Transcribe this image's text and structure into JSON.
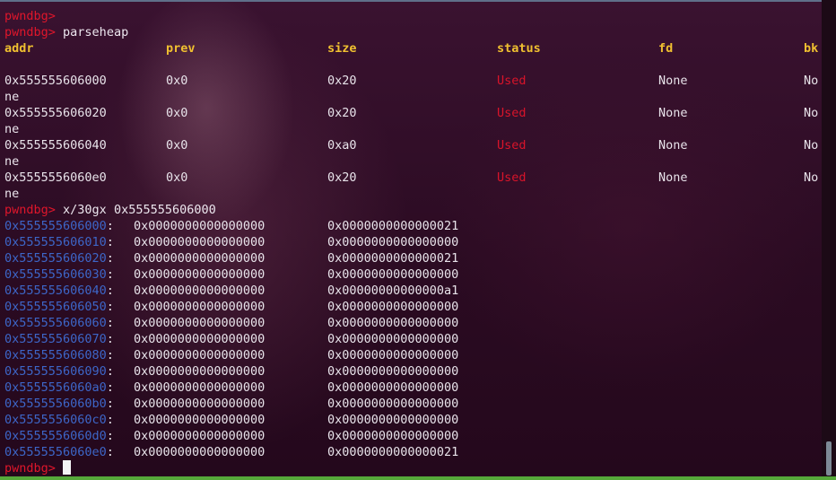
{
  "prompt": "pwndbg>",
  "commands": {
    "parseheap": "parseheap",
    "examine": "x/30gx 0x555555606000"
  },
  "heap_table": {
    "headers": [
      "addr",
      "prev",
      "size",
      "status",
      "fd",
      "bk"
    ],
    "rows": [
      {
        "addr": "0x555555606000",
        "prev": "0x0",
        "size": "0x20",
        "status": "Used",
        "fd": "None",
        "bk": "No",
        "cont": "ne"
      },
      {
        "addr": "0x555555606020",
        "prev": "0x0",
        "size": "0x20",
        "status": "Used",
        "fd": "None",
        "bk": "No",
        "cont": "ne"
      },
      {
        "addr": "0x555555606040",
        "prev": "0x0",
        "size": "0xa0",
        "status": "Used",
        "fd": "None",
        "bk": "No",
        "cont": "ne"
      },
      {
        "addr": "0x5555556060e0",
        "prev": "0x0",
        "size": "0x20",
        "status": "Used",
        "fd": "None",
        "bk": "No",
        "cont": "ne"
      }
    ]
  },
  "memory_dump": [
    {
      "addr": "0x555555606000",
      "v1": "0x0000000000000000",
      "v2": "0x0000000000000021"
    },
    {
      "addr": "0x555555606010",
      "v1": "0x0000000000000000",
      "v2": "0x0000000000000000"
    },
    {
      "addr": "0x555555606020",
      "v1": "0x0000000000000000",
      "v2": "0x0000000000000021"
    },
    {
      "addr": "0x555555606030",
      "v1": "0x0000000000000000",
      "v2": "0x0000000000000000"
    },
    {
      "addr": "0x555555606040",
      "v1": "0x0000000000000000",
      "v2": "0x00000000000000a1"
    },
    {
      "addr": "0x555555606050",
      "v1": "0x0000000000000000",
      "v2": "0x0000000000000000"
    },
    {
      "addr": "0x555555606060",
      "v1": "0x0000000000000000",
      "v2": "0x0000000000000000"
    },
    {
      "addr": "0x555555606070",
      "v1": "0x0000000000000000",
      "v2": "0x0000000000000000"
    },
    {
      "addr": "0x555555606080",
      "v1": "0x0000000000000000",
      "v2": "0x0000000000000000"
    },
    {
      "addr": "0x555555606090",
      "v1": "0x0000000000000000",
      "v2": "0x0000000000000000"
    },
    {
      "addr": "0x5555556060a0",
      "v1": "0x0000000000000000",
      "v2": "0x0000000000000000"
    },
    {
      "addr": "0x5555556060b0",
      "v1": "0x0000000000000000",
      "v2": "0x0000000000000000"
    },
    {
      "addr": "0x5555556060c0",
      "v1": "0x0000000000000000",
      "v2": "0x0000000000000000"
    },
    {
      "addr": "0x5555556060d0",
      "v1": "0x0000000000000000",
      "v2": "0x0000000000000000"
    },
    {
      "addr": "0x5555556060e0",
      "v1": "0x0000000000000000",
      "v2": "0x0000000000000021"
    }
  ],
  "colors": {
    "prompt": "#e0162b",
    "header": "#f0c030",
    "status_used": "#d9142a",
    "address": "#3d66c8",
    "text": "#e8e3ea",
    "accent_bar": "#56a93a"
  }
}
